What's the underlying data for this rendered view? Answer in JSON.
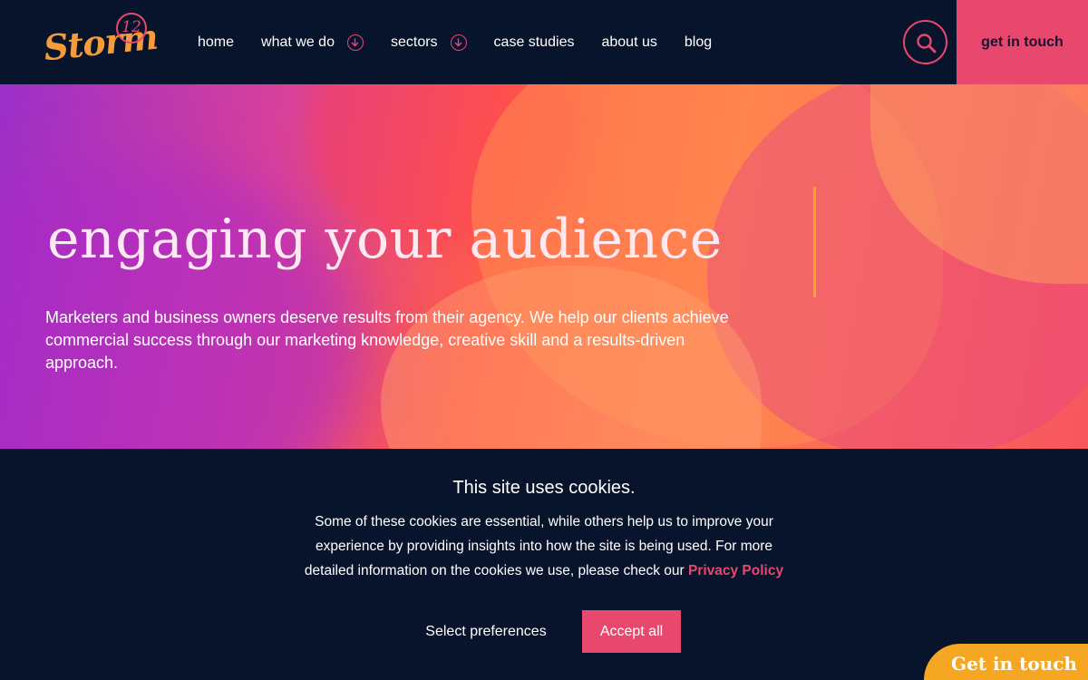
{
  "header": {
    "logo_text": "Storm",
    "logo_badge": "12",
    "nav": [
      {
        "label": "home"
      },
      {
        "label": "what we do"
      },
      {
        "label": "sectors"
      },
      {
        "label": "case studies"
      },
      {
        "label": "about us"
      },
      {
        "label": "blog"
      }
    ],
    "get_in_touch_label": "get in touch"
  },
  "hero": {
    "title": "engaging your audience",
    "text": "Marketers and business owners deserve results from their agency. We help our clients achieve commercial success through our marketing knowledge, creative skill and a results-driven approach."
  },
  "cookie_banner": {
    "title": "This site uses cookies.",
    "body": "Some of these cookies are essential, while others help us to improve your experience by providing insights into how the site is being used. For more detailed information on the cookies we use, please check our",
    "privacy_link": "Privacy Policy",
    "preferences_label": "Select preferences",
    "accept_label": "Accept all"
  },
  "floating_cta": {
    "label": "Get in touch"
  },
  "colors": {
    "navy": "#08142c",
    "pink": "#e8476e",
    "orange": "#f5a623"
  },
  "icons": {
    "search": "search-icon",
    "dropdown": "chevron-down-icon"
  }
}
